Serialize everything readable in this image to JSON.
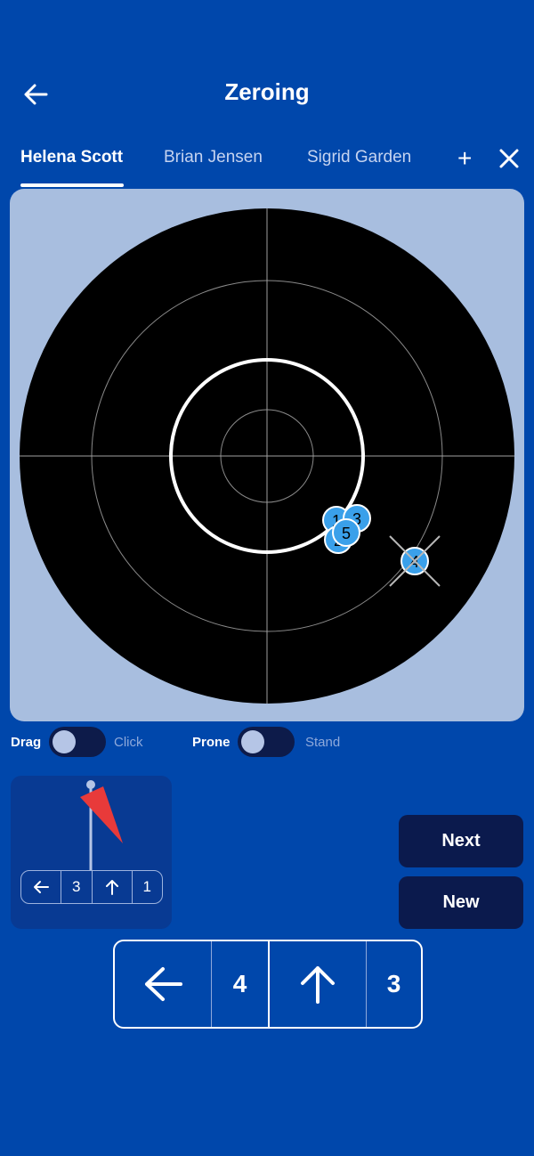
{
  "header": {
    "title": "Zeroing"
  },
  "tabs": [
    {
      "label": "Helena Scott",
      "active": true
    },
    {
      "label": "Brian Jensen",
      "active": false
    },
    {
      "label": "Sigrid Garden",
      "active": false
    }
  ],
  "tab_add_label": "+",
  "target": {
    "shots": [
      {
        "label": "1"
      },
      {
        "label": "3"
      },
      {
        "label": "2"
      },
      {
        "label": "5"
      }
    ],
    "center_marker": {
      "label": "4"
    }
  },
  "toggles": {
    "mode": {
      "left": "Drag",
      "right": "Click"
    },
    "position": {
      "left": "Prone",
      "right": "Stand"
    }
  },
  "preview": {
    "windage_value": "3",
    "elevation_value": "1"
  },
  "buttons": {
    "next": "Next",
    "new": "New"
  },
  "adjustment": {
    "windage_value": "4",
    "elevation_value": "3"
  },
  "colors": {
    "background": "#0047ab",
    "target_panel": "#a8bedf",
    "shot": "#3aa0ea",
    "button": "#0b1a4d",
    "flag": "#e83a3a"
  }
}
